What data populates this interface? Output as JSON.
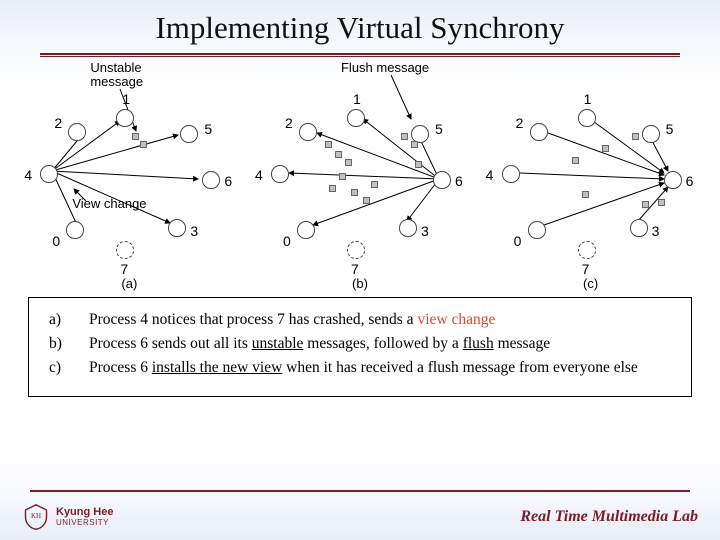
{
  "title": "Implementing Virtual Synchrony",
  "labels": {
    "unstable": "Unstable message",
    "flush": "Flush message",
    "view_change": "View change"
  },
  "nodes": [
    "0",
    "1",
    "2",
    "3",
    "4",
    "5",
    "6",
    "7"
  ],
  "panels": {
    "a": "(a)",
    "b": "(b)",
    "c": "(c)"
  },
  "items": {
    "a": {
      "key": "a)",
      "text_pre": "Process 4 notices that process 7 has crashed, sends a ",
      "hl": "view change"
    },
    "b": {
      "key": "b)",
      "text_pre": "Process 6 sends out all its ",
      "u1": "unstable",
      "mid": " messages, followed by a ",
      "u2": "flush",
      "post": " message"
    },
    "c": {
      "key": "c)",
      "text_pre": "Process 6 ",
      "u1": "installs the new view",
      "post": " when it has received a flush message from everyone else"
    }
  },
  "footer": {
    "uni_line1": "Kyung Hee",
    "uni_line2": "UNIVERSITY",
    "lab": "Real Time Multimedia Lab"
  }
}
